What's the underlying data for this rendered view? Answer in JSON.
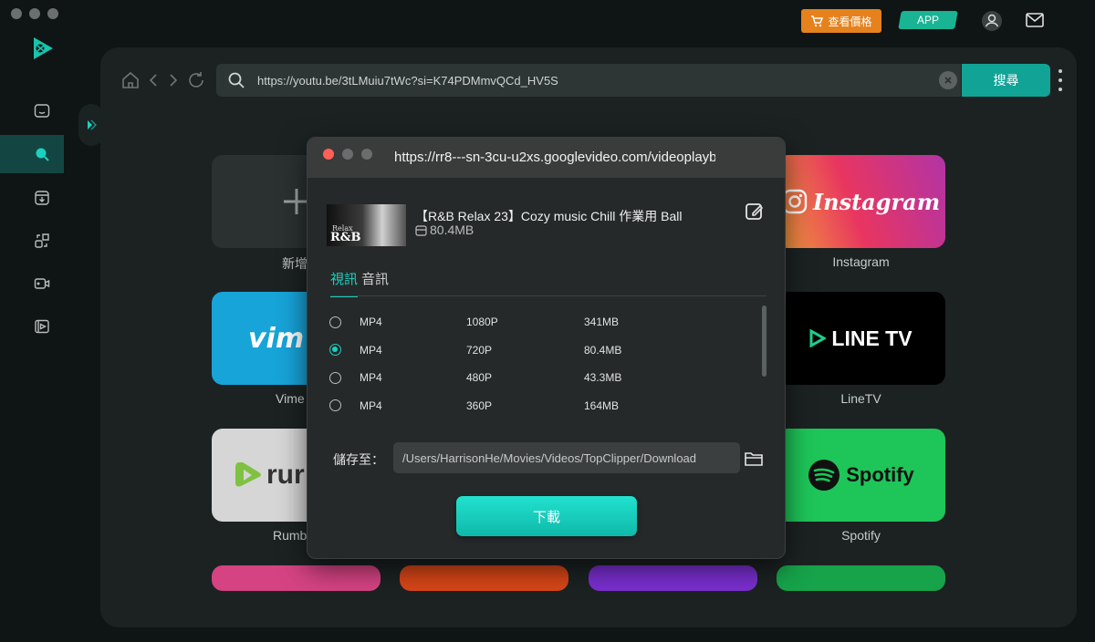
{
  "topbar": {
    "price_label": "查看價格",
    "app_label": "APP"
  },
  "browser": {
    "url": "https://youtu.be/3tLMuiu7tWc?si=K74PDMmvQCd_HV5S",
    "search_label": "搜尋"
  },
  "tiles": [
    {
      "label": "新增"
    },
    {
      "label": "Instagram"
    },
    {
      "label": "Vime",
      "logo": "vim"
    },
    {
      "label": "LineTV",
      "logo": "LINE TV"
    },
    {
      "label": "Rumb",
      "logo": "rur"
    },
    {
      "label": "Spotify",
      "logo": "Spotify"
    },
    {
      "logo_insta": "Instagram"
    }
  ],
  "dialog": {
    "title": "https://rr8---sn-3cu-u2xs.googlevideo.com/videoplayback",
    "thumbnail_text": "R&B",
    "thumbnail_small_text": "Relax",
    "video_title": "【R&B Relax 23】Cozy music  Chill  作業用  Ball",
    "video_size": "80.4MB",
    "tab_video": "視訊",
    "tab_audio": "音訊",
    "formats": [
      {
        "type": "MP4",
        "resolution": "1080P",
        "size": "341MB",
        "selected": false
      },
      {
        "type": "MP4",
        "resolution": "720P",
        "size": "80.4MB",
        "selected": true
      },
      {
        "type": "MP4",
        "resolution": "480P",
        "size": "43.3MB",
        "selected": false
      },
      {
        "type": "MP4",
        "resolution": "360P",
        "size": "164MB",
        "selected": false
      }
    ],
    "save_label": "儲存至：",
    "save_path": "/Users/HarrisonHe/Movies/Videos/TopClipper/Download",
    "download_label": "下載"
  },
  "colors": {
    "accent": "#1ad1c0",
    "price_button": "#e5821d",
    "app_button": "#18b493",
    "close_dot": "#ff5f57"
  }
}
